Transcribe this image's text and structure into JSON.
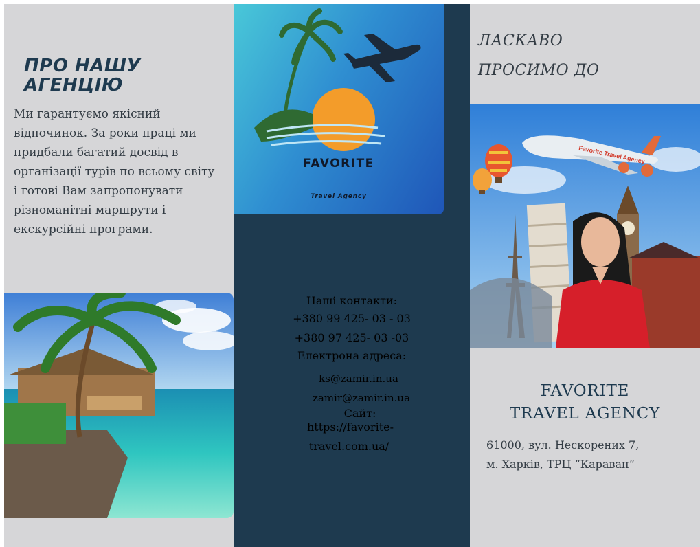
{
  "left": {
    "about_title": "ПРО НАШУ АГЕНЦІЮ",
    "about_text": "Ми гарантуємо якісний відпочинок. За роки праці ми придбали багатий досвід в організації турів по всьому світу і готові Вам запропонувати різноманітні маршрути і екскурсійні програми."
  },
  "logo": {
    "name": "FAVORITE",
    "subtitle": "Travel Agency"
  },
  "contacts": {
    "heading": "Наші контакти:",
    "phone_1": "+380 99 425- 03 - 03",
    "phone_2": "+380 97 425- 03 -03",
    "email_label": "Електрона адреса:",
    "email_1": "ks@zamir.in.ua",
    "email_2": "zamir@zamir.in.ua",
    "site_label": "Сайт:",
    "site_line_1": "https://favorite-",
    "site_line_2": "travel.com.ua/"
  },
  "right": {
    "welcome_line_1": "ЛАСКАВО",
    "welcome_line_2": "ПРОСИМО ДО",
    "plane_text": "Favorite Travel Agency",
    "brand_line_1": "FAVORITE",
    "brand_line_2": "TRAVEL AGENCY",
    "address_line_1": "61000, вул. Нескорених 7,",
    "address_line_2": "м. Харків, ТРЦ “Караван”"
  },
  "colors": {
    "panel_gray": "#d6d6d8",
    "navy": "#1e3a4f",
    "logo_gradient_start": "#49c8d8",
    "logo_gradient_end": "#1f56b8",
    "sun": "#f39c2a"
  }
}
